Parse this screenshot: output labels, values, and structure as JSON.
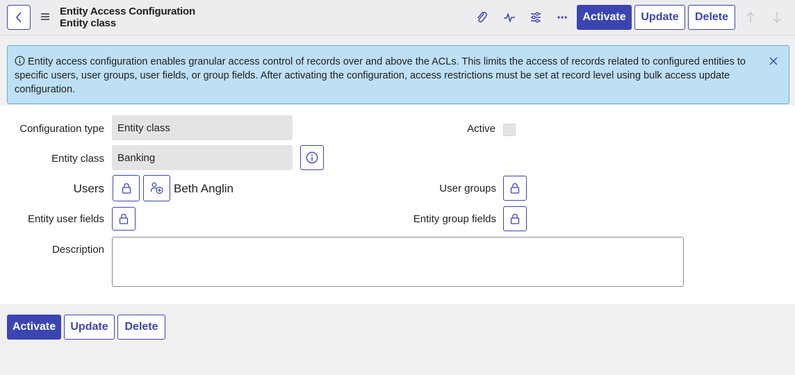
{
  "header": {
    "title": "Entity Access Configuration",
    "subtitle": "Entity class",
    "icons": [
      "back-icon",
      "menu-icon",
      "paperclip-icon",
      "activity-icon",
      "sliders-icon",
      "more-icon",
      "arrow-up-icon",
      "arrow-down-icon"
    ],
    "activate_label": "Activate",
    "update_label": "Update",
    "delete_label": "Delete"
  },
  "banner": {
    "icon": "info-icon",
    "text": "Entity access configuration enables granular access control of records over and above the ACLs. This limits the access of records related to configured entities to specific users, user groups, user fields, or group fields. After activating the configuration, access restrictions must be set at record level using bulk access update configuration.",
    "close_icon": "close-icon"
  },
  "form": {
    "configuration_type_label": "Configuration type",
    "configuration_type_value": "Entity class",
    "active_label": "Active",
    "active_checked": false,
    "entity_class_label": "Entity class",
    "entity_class_value": "Banking",
    "users_label": "Users",
    "users_value": "Beth Anglin",
    "user_groups_label": "User groups",
    "entity_user_fields_label": "Entity user fields",
    "entity_group_fields_label": "Entity group fields",
    "description_label": "Description",
    "description_value": ""
  },
  "footer": {
    "activate_label": "Activate",
    "update_label": "Update",
    "delete_label": "Delete"
  },
  "colors": {
    "accent": "#3b45b1",
    "banner_bg": "#bde0f5",
    "field_bg": "#e4e4e7"
  }
}
